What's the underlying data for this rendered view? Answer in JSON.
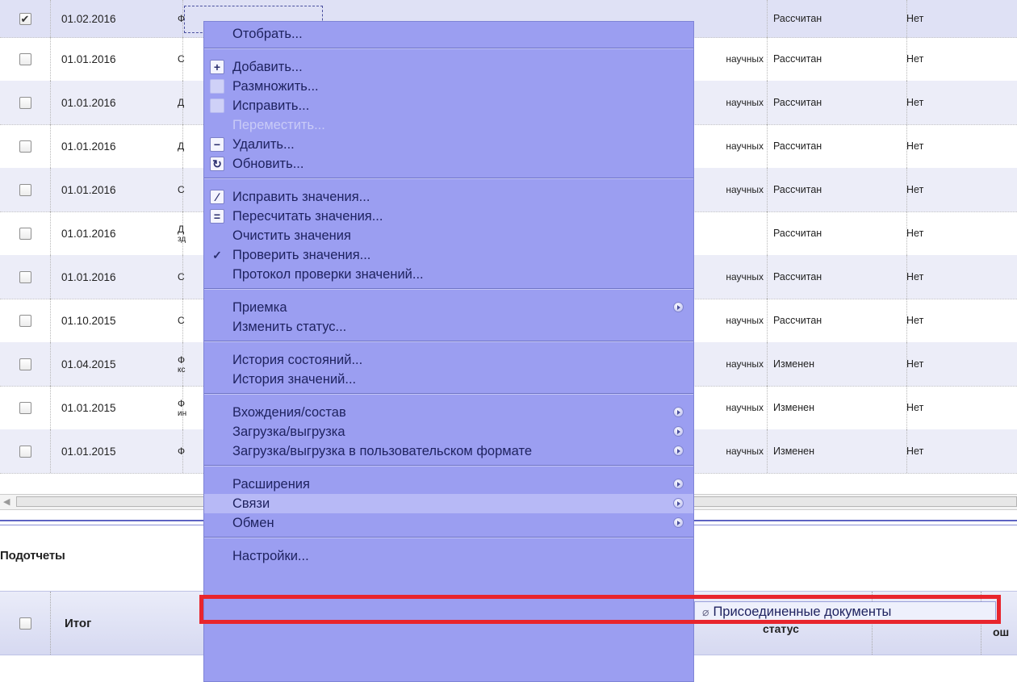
{
  "rows": [
    {
      "checked": true,
      "date": "01.02.2016",
      "name": "Ф",
      "tail": "",
      "status": "Рассчитан",
      "flag": "Нет"
    },
    {
      "checked": false,
      "date": "01.01.2016",
      "name": "С",
      "tail": "научных",
      "status": "Рассчитан",
      "flag": "Нет"
    },
    {
      "checked": false,
      "date": "01.01.2016",
      "name": "Д",
      "tail": "научных",
      "status": "Рассчитан",
      "flag": "Нет"
    },
    {
      "checked": false,
      "date": "01.01.2016",
      "name": "Д",
      "tail": "научных",
      "status": "Рассчитан",
      "flag": "Нет"
    },
    {
      "checked": false,
      "date": "01.01.2016",
      "name": "С",
      "tail": "научных",
      "status": "Рассчитан",
      "flag": "Нет"
    },
    {
      "checked": false,
      "date": "01.01.2016",
      "name": "Д",
      "name2": "зд",
      "tail": "",
      "status": "Рассчитан",
      "flag": "Нет"
    },
    {
      "checked": false,
      "date": "01.01.2016",
      "name": "С",
      "tail": "научных",
      "status": "Рассчитан",
      "flag": "Нет"
    },
    {
      "checked": false,
      "date": "01.10.2015",
      "name": "С",
      "tail": "научных",
      "status": "Рассчитан",
      "flag": "Нет"
    },
    {
      "checked": false,
      "date": "01.04.2015",
      "name": "Ф",
      "name2": "кс",
      "tail": "научных",
      "status": "Изменен",
      "flag": "Нет"
    },
    {
      "checked": false,
      "date": "01.01.2015",
      "name": "Ф",
      "name2": "ин",
      "tail": "научных",
      "status": "Изменен",
      "flag": "Нет"
    },
    {
      "checked": false,
      "date": "01.01.2015",
      "name": "Ф",
      "tail": "научных",
      "status": "Изменен",
      "flag": "Нет"
    }
  ],
  "subpanel": {
    "title": "Подотчеты",
    "header_itog": "Итог",
    "header_status_fragment": "статус",
    "header_right_fragment": "ош"
  },
  "menu": {
    "items": [
      {
        "label": "Отобрать...",
        "icon": "",
        "disabled": false,
        "submenu": false
      },
      {
        "sep": true
      },
      {
        "label": "Добавить...",
        "icon": "plus-icon",
        "disabled": false,
        "submenu": false
      },
      {
        "label": "Размножить...",
        "icon": "duplicate-icon",
        "disabled": false,
        "submenu": false
      },
      {
        "label": "Исправить...",
        "icon": "edit-icon",
        "disabled": false,
        "submenu": false
      },
      {
        "label": "Переместить...",
        "icon": "",
        "disabled": true,
        "submenu": false
      },
      {
        "label": "Удалить...",
        "icon": "minus-icon",
        "disabled": false,
        "submenu": false
      },
      {
        "label": "Обновить...",
        "icon": "refresh-icon",
        "disabled": false,
        "submenu": false
      },
      {
        "sep": true
      },
      {
        "label": "Исправить значения...",
        "icon": "pencil-icon",
        "disabled": false,
        "submenu": false
      },
      {
        "label": "Пересчитать значения...",
        "icon": "equals-icon",
        "disabled": false,
        "submenu": false
      },
      {
        "label": "Очистить значения",
        "icon": "",
        "disabled": false,
        "submenu": false
      },
      {
        "label": "Проверить значения...",
        "icon": "check-icon",
        "disabled": false,
        "submenu": false
      },
      {
        "label": "Протокол проверки значений...",
        "icon": "",
        "disabled": false,
        "submenu": false
      },
      {
        "sep": true
      },
      {
        "label": "Приемка",
        "icon": "",
        "disabled": false,
        "submenu": true
      },
      {
        "label": "Изменить статус...",
        "icon": "",
        "disabled": false,
        "submenu": false
      },
      {
        "sep": true
      },
      {
        "label": "История состояний...",
        "icon": "",
        "disabled": false,
        "submenu": false
      },
      {
        "label": "История значений...",
        "icon": "",
        "disabled": false,
        "submenu": false
      },
      {
        "sep": true
      },
      {
        "label": "Вхождения/состав",
        "icon": "",
        "disabled": false,
        "submenu": true
      },
      {
        "label": "Загрузка/выгрузка",
        "icon": "",
        "disabled": false,
        "submenu": true
      },
      {
        "label": "Загрузка/выгрузка в пользовательском формате",
        "icon": "",
        "disabled": false,
        "submenu": true
      },
      {
        "sep": true
      },
      {
        "label": "Расширения",
        "icon": "",
        "disabled": false,
        "submenu": true
      },
      {
        "label": "Связи",
        "icon": "",
        "disabled": false,
        "submenu": true,
        "highlighted": true
      },
      {
        "label": "Обмен",
        "icon": "",
        "disabled": false,
        "submenu": true
      },
      {
        "sep": true
      },
      {
        "label": "Настройки...",
        "icon": "",
        "disabled": false,
        "submenu": false
      }
    ]
  },
  "submenu": {
    "icon": "paperclip-icon",
    "label": "Присоединенные документы"
  },
  "colors": {
    "menu_bg": "#9b9ef1",
    "highlight_border": "#e8252d",
    "row_alt": "#ecedf8"
  }
}
